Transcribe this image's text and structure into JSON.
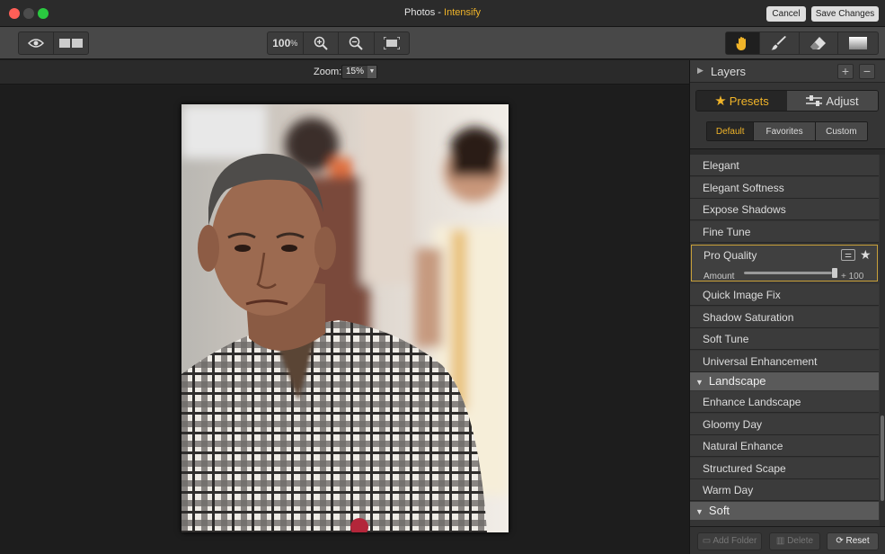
{
  "window": {
    "app_name": "Photos",
    "separator": " - ",
    "module_name": "Intensify",
    "cancel_label": "Cancel",
    "save_label": "Save Changes"
  },
  "toolbar": {
    "view_tools": [
      "eye-icon",
      "split-view-icon"
    ],
    "zoom_actual_label": "100",
    "zoom_actual_unit": "%",
    "zoom_tools": [
      "zoom-in-icon",
      "zoom-out-icon",
      "fit-to-window-icon"
    ],
    "edit_tools": [
      "hand-icon",
      "brush-icon",
      "eraser-icon",
      "gradient-icon"
    ],
    "active_tool": "hand-icon"
  },
  "zoom": {
    "label": "Zoom:",
    "value": "15%"
  },
  "photo": {
    "subject": "portrait-photo"
  },
  "layers": {
    "title": "Layers",
    "add_icon": "+",
    "remove_icon": "−"
  },
  "mode_tabs": [
    {
      "label": "Presets",
      "icon": "star-icon",
      "active": true
    },
    {
      "label": "Adjust",
      "icon": "sliders-icon",
      "active": false
    }
  ],
  "preset_tabs": [
    {
      "label": "Default",
      "active": true
    },
    {
      "label": "Favorites",
      "active": false
    },
    {
      "label": "Custom",
      "active": false
    }
  ],
  "presets": {
    "list_a": [
      "Elegant",
      "Elegant Softness",
      "Expose Shadows",
      "Fine Tune"
    ],
    "selected": {
      "name": "Pro Quality",
      "amount_label": "Amount",
      "amount_value": 100,
      "amount_value_text": "+ 100",
      "is_favorite": true
    },
    "list_b": [
      "Quick Image Fix",
      "Shadow Saturation",
      "Soft Tune",
      "Universal Enhancement"
    ],
    "groups": [
      {
        "name": "Landscape",
        "items": [
          "Enhance Landscape",
          "Gloomy Day",
          "Natural Enhance",
          "Structured Scape",
          "Warm Day"
        ]
      },
      {
        "name": "Soft",
        "items": []
      }
    ]
  },
  "footer": {
    "add_folder_label": "Add Folder",
    "delete_label": "Delete",
    "reset_label": "Reset"
  },
  "colors": {
    "accent": "#f0b429",
    "panel_bg": "#353535",
    "canvas_bg": "#1d1d1d"
  }
}
